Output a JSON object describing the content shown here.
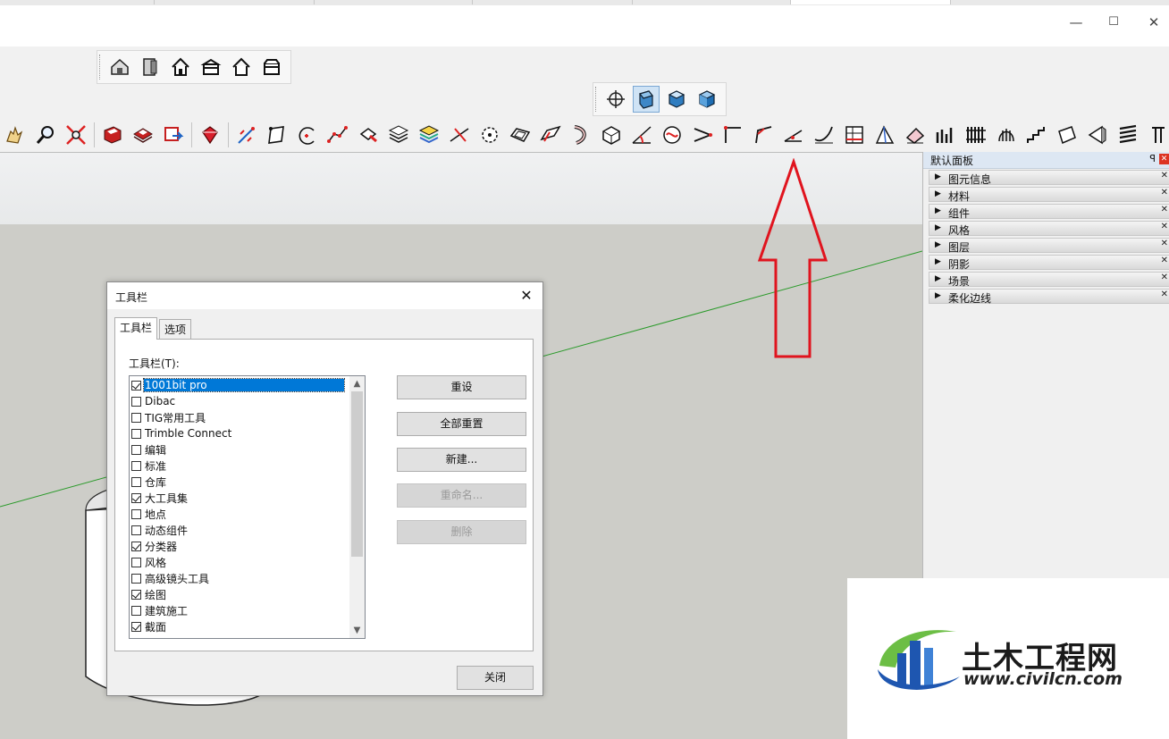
{
  "window": {
    "minimize_glyph": "—",
    "maximize_glyph": "☐",
    "close_glyph": "✕"
  },
  "tray": {
    "title": "默认面板",
    "pin_glyph": "ꟼ",
    "close_glyph": "✕",
    "panels": [
      "图元信息",
      "材料",
      "组件",
      "风格",
      "图层",
      "阴影",
      "场景",
      "柔化边线"
    ]
  },
  "dialog": {
    "title": "工具栏",
    "close_glyph": "✕",
    "tabs": [
      "工具栏",
      "选项"
    ],
    "list_label": "工具栏(T):",
    "items": [
      {
        "label": "1001bit pro",
        "checked": true,
        "selected": true
      },
      {
        "label": "Dibac",
        "checked": false
      },
      {
        "label": "TIG常用工具",
        "checked": false
      },
      {
        "label": "Trimble Connect",
        "checked": false
      },
      {
        "label": "编辑",
        "checked": false
      },
      {
        "label": "标准",
        "checked": false
      },
      {
        "label": "仓库",
        "checked": false
      },
      {
        "label": "大工具集",
        "checked": true
      },
      {
        "label": "地点",
        "checked": false
      },
      {
        "label": "动态组件",
        "checked": false
      },
      {
        "label": "分类器",
        "checked": true
      },
      {
        "label": "风格",
        "checked": false
      },
      {
        "label": "高级镜头工具",
        "checked": false
      },
      {
        "label": "绘图",
        "checked": true
      },
      {
        "label": "建筑施工",
        "checked": false
      },
      {
        "label": "截面",
        "checked": true
      }
    ],
    "buttons": {
      "reset": "重设",
      "reset_all": "全部重置",
      "new": "新建...",
      "rename": "重命名...",
      "delete": "删除"
    },
    "close_label": "关闭",
    "scroll_up": "▲",
    "scroll_down": "▼"
  },
  "watermark": {
    "name": "土木工程网",
    "url": "www.civilcn.com"
  },
  "colors": {
    "selection": "#0078d7",
    "annotation_arrow": "#e0141e",
    "axis_green": "#2a9a2a"
  }
}
